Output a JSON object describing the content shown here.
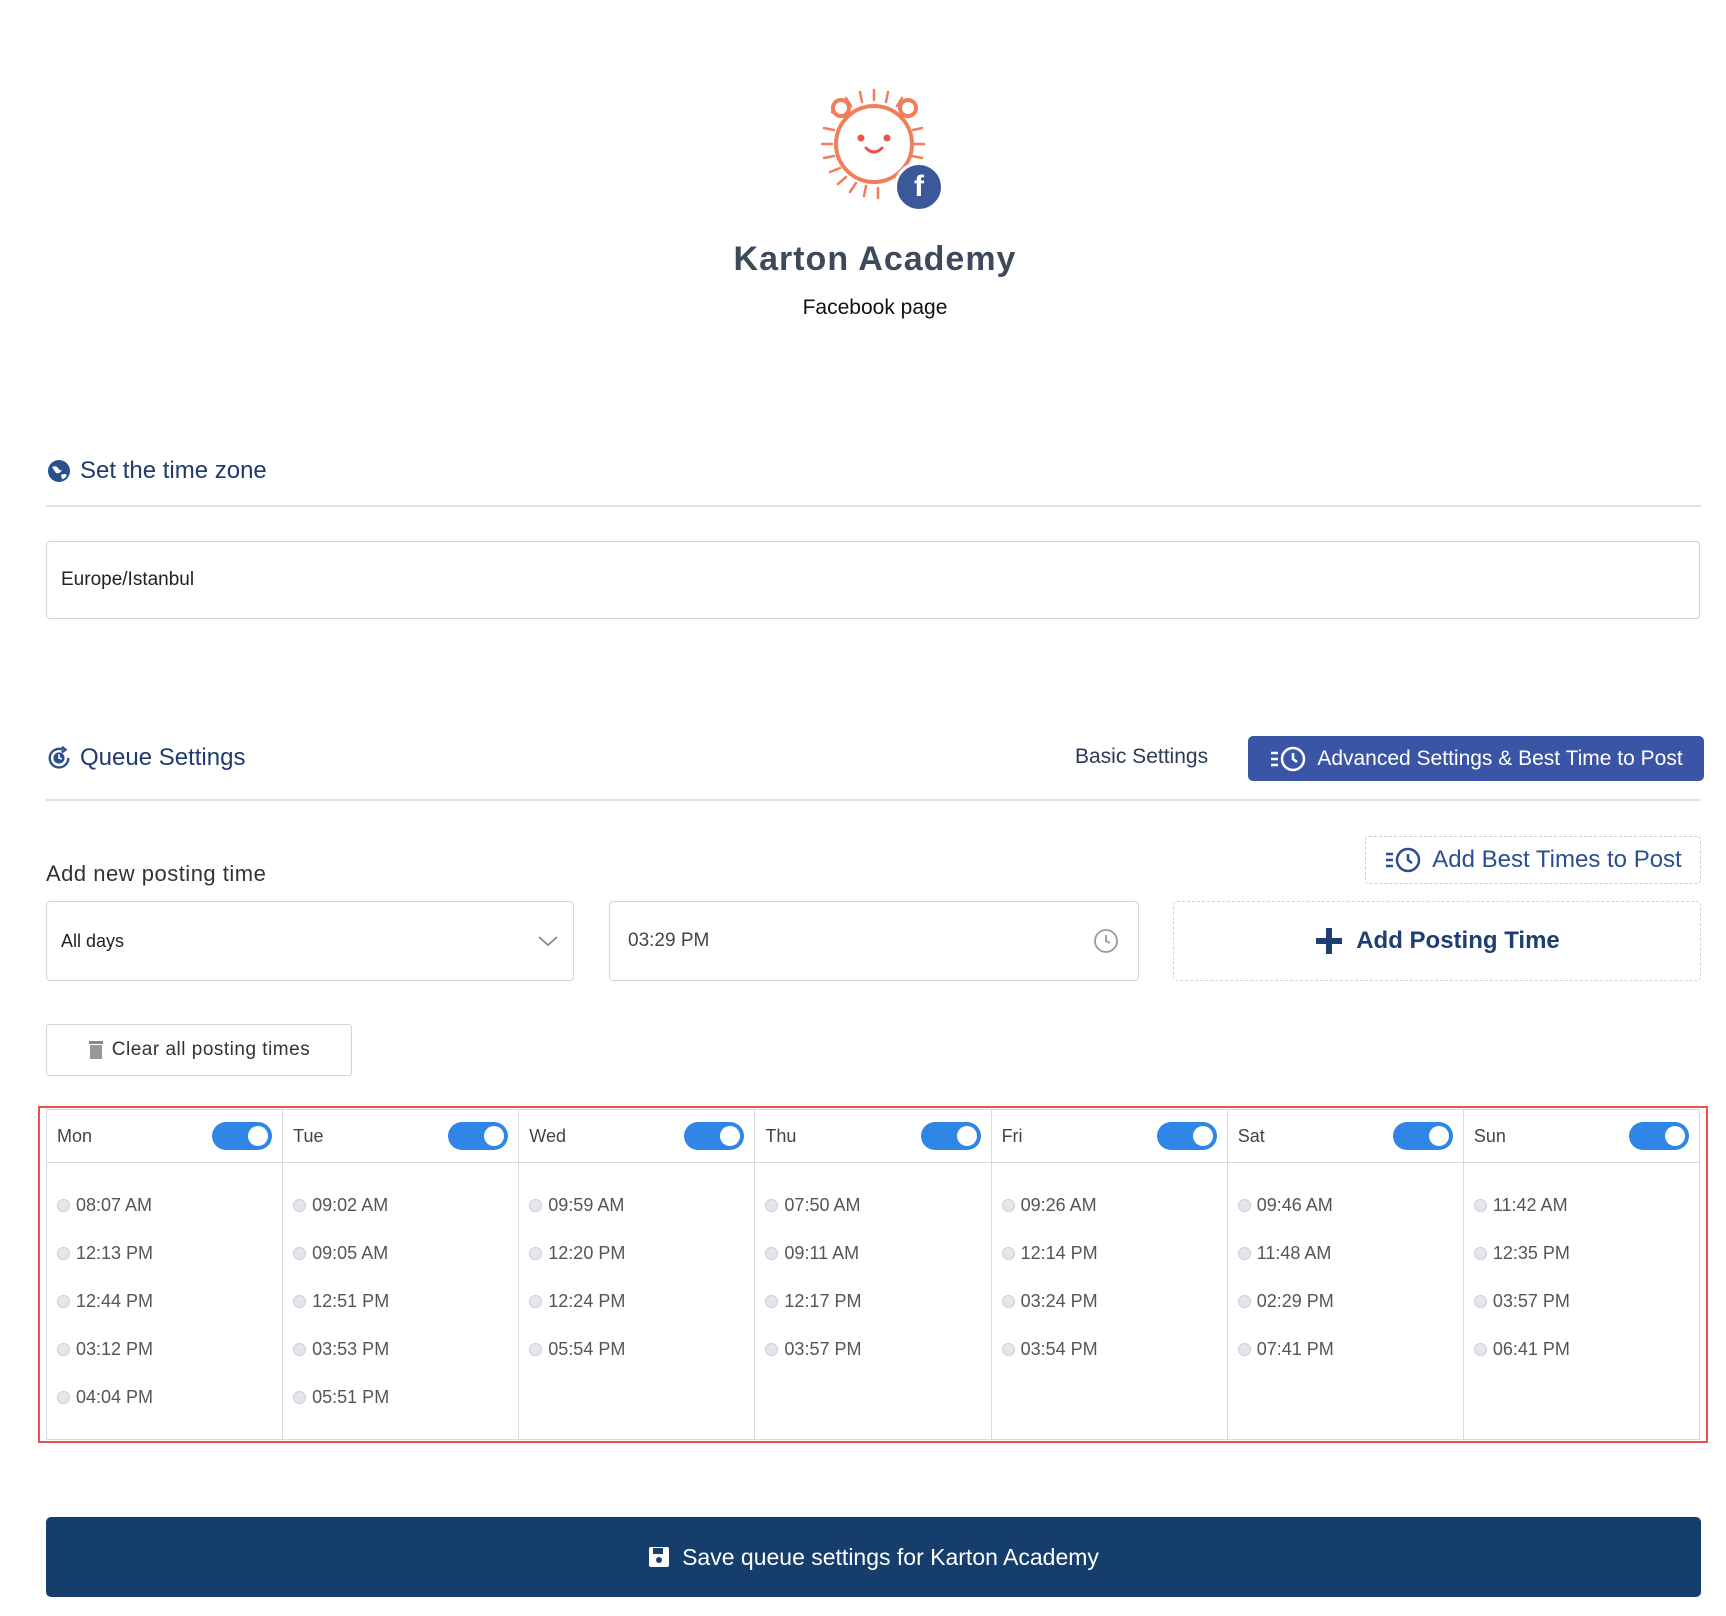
{
  "profile": {
    "name": "Karton Academy",
    "subtitle": "Facebook page"
  },
  "timezone": {
    "title": "Set the time zone",
    "value": "Europe/Istanbul"
  },
  "queue": {
    "title": "Queue Settings",
    "basic_label": "Basic Settings",
    "advanced_label": "Advanced Settings & Best Time to Post"
  },
  "add_time": {
    "label": "Add new posting time",
    "best_times_label": "Add Best Times to Post",
    "day_select_value": "All days",
    "time_value": "03:29 PM",
    "add_button_label": "Add Posting Time",
    "clear_label": "Clear all posting times"
  },
  "schedule": [
    {
      "day": "Mon",
      "enabled": true,
      "times": [
        "08:07 AM",
        "12:13 PM",
        "12:44 PM",
        "03:12 PM",
        "04:04 PM"
      ]
    },
    {
      "day": "Tue",
      "enabled": true,
      "times": [
        "09:02 AM",
        "09:05 AM",
        "12:51 PM",
        "03:53 PM",
        "05:51 PM"
      ]
    },
    {
      "day": "Wed",
      "enabled": true,
      "times": [
        "09:59 AM",
        "12:20 PM",
        "12:24 PM",
        "05:54 PM"
      ]
    },
    {
      "day": "Thu",
      "enabled": true,
      "times": [
        "07:50 AM",
        "09:11 AM",
        "12:17 PM",
        "03:57 PM"
      ]
    },
    {
      "day": "Fri",
      "enabled": true,
      "times": [
        "09:26 AM",
        "12:14 PM",
        "03:24 PM",
        "03:54 PM"
      ]
    },
    {
      "day": "Sat",
      "enabled": true,
      "times": [
        "09:46 AM",
        "11:48 AM",
        "02:29 PM",
        "07:41 PM"
      ]
    },
    {
      "day": "Sun",
      "enabled": true,
      "times": [
        "11:42 AM",
        "12:35 PM",
        "03:57 PM",
        "06:41 PM"
      ]
    }
  ],
  "save_label": "Save queue settings for Karton Academy",
  "colors": {
    "accent": "#3b55a6",
    "primary": "#163e6c",
    "toggle": "#2f86e6",
    "highlight": "#e8534f",
    "avatar": "#f27d5a",
    "facebook": "#3b5998"
  }
}
